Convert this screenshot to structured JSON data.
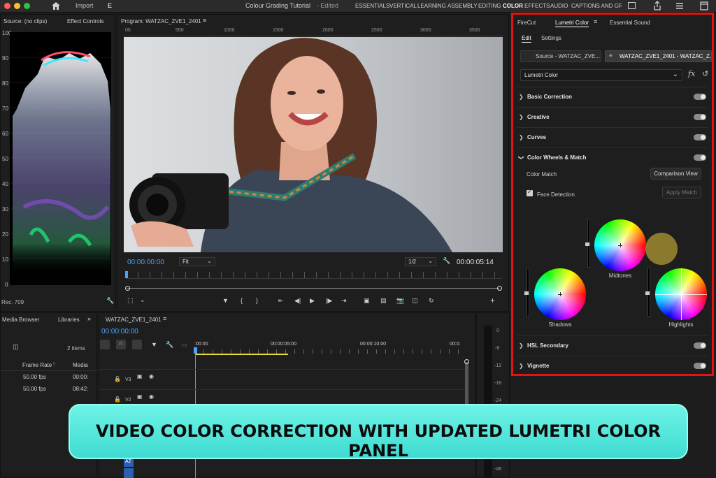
{
  "app": {
    "import_label": "Import",
    "edit_tab_clipped": "E",
    "project_title": "Colour Grading Tutorial",
    "status": "- Edited"
  },
  "workspaces": [
    "ESSENTIALS",
    "VERTICAL",
    "LEARNING",
    "ASSEMBLY",
    "EDITING",
    "COLOR",
    "EFFECTS",
    "AUDIO",
    "CAPTIONS AND GRA"
  ],
  "source_panel": {
    "tab_source": "Source: (no clips)",
    "tab_effect_controls": "Effect Controls",
    "scope_scale": [
      "100",
      "90",
      "80",
      "70",
      "60",
      "50",
      "40",
      "30",
      "20",
      "10",
      "0"
    ],
    "scope_footer": "Rec. 709"
  },
  "program_monitor": {
    "title": "Program: WATZAC_ZVE1_2401",
    "ruler": [
      "00",
      "500",
      "1000",
      "1500",
      "2000",
      "2500",
      "3000",
      "3500"
    ],
    "timecode_current": "00:00:00:00",
    "fit_label": "Fit",
    "resolution": "1/2",
    "timecode_duration": "00:00:05:14"
  },
  "project_panel": {
    "tab_media_browser": "Media Browser",
    "tab_libraries": "Libraries",
    "item_count": "2 items",
    "col_frame_rate": "Frame Rate",
    "col_media": "Media",
    "rows": [
      {
        "fps": "50.00 fps",
        "media": "00:00:"
      },
      {
        "fps": "50.00 fps",
        "media": "08:42:"
      }
    ]
  },
  "timeline": {
    "tab": "WATZAC_ZVE1_2401",
    "timecode": "00:00:00:00",
    "ruler": [
      ":00:00",
      "00:00:05:00",
      "00:00:10:00",
      "00:0:"
    ],
    "tracks": [
      "V3",
      "V2",
      "A2"
    ],
    "meter_scale": [
      "0",
      "-6",
      "-12",
      "-18",
      "-24",
      "-48"
    ]
  },
  "lumetri": {
    "tabs": [
      "FireCut",
      "Lumetri Color",
      "Essential Sound"
    ],
    "subtabs": [
      "Edit",
      "Settings"
    ],
    "source_clip": "Source - WATZAC_ZVE...",
    "target_clip": "WATZAC_ZVE1_2401 - WATZAC_Z...",
    "effect_select": "Lumetri Color",
    "sections_top": [
      "Basic Correction",
      "Creative",
      "Curves"
    ],
    "color_wheels_section": "Color Wheels & Match",
    "color_match_label": "Color Match",
    "comparison_view_button": "Comparison View",
    "face_detection_label": "Face Detection",
    "apply_match_button": "Apply Match",
    "wheels": {
      "midtones": "Midtones",
      "shadows": "Shadows",
      "highlights": "Highlights"
    },
    "swatch_color": "#8b7a2e",
    "sections_bottom": [
      "HSL Secondary",
      "Vignette"
    ]
  },
  "banner": {
    "text": "VIDEO COLOR CORRECTION WITH UPDATED LUMETRI COLOR PANEL"
  },
  "colors": {
    "highlight_border": "#e01414",
    "accent_blue": "#4aa3ff",
    "banner_bg": "#3fdbd2"
  }
}
